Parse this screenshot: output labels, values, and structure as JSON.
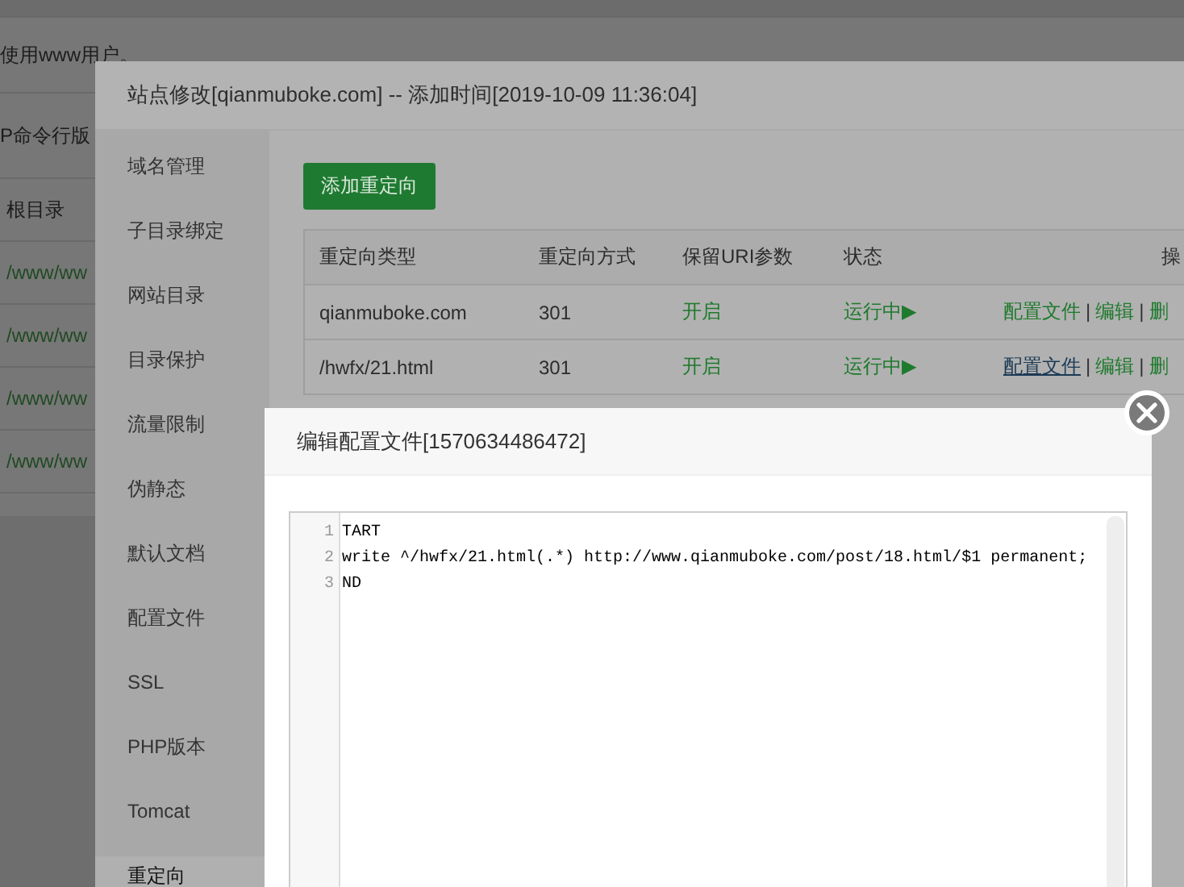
{
  "background_page": {
    "notice": "使用www用户。",
    "rows": [
      "P命令行版",
      "根目录",
      "/www/ww",
      "/www/ww",
      "/www/ww",
      "/www/ww"
    ]
  },
  "site_dialog": {
    "title": "站点修改[qianmuboke.com] -- 添加时间[2019-10-09 11:36:04]",
    "sidebar": {
      "items": [
        {
          "label": "域名管理",
          "selected": false
        },
        {
          "label": "子目录绑定",
          "selected": false
        },
        {
          "label": "网站目录",
          "selected": false
        },
        {
          "label": "目录保护",
          "selected": false
        },
        {
          "label": "流量限制",
          "selected": false
        },
        {
          "label": "伪静态",
          "selected": false
        },
        {
          "label": "默认文档",
          "selected": false
        },
        {
          "label": "配置文件",
          "selected": false
        },
        {
          "label": "SSL",
          "selected": false
        },
        {
          "label": "PHP版本",
          "selected": false
        },
        {
          "label": "Tomcat",
          "selected": false
        },
        {
          "label": "重定向",
          "selected": true
        }
      ]
    },
    "add_button": "添加重定向",
    "table": {
      "columns": [
        "重定向类型",
        "重定向方式",
        "保留URI参数",
        "状态",
        "操"
      ],
      "action_separator": "|",
      "rows": [
        {
          "type": "qianmuboke.com",
          "method": "301",
          "keep_uri": "开启",
          "status": "运行中▶",
          "actions": [
            {
              "label": "配置文件",
              "hover": false
            },
            {
              "label": "编辑",
              "hover": false
            },
            {
              "label": "删",
              "hover": false
            }
          ]
        },
        {
          "type": "/hwfx/21.html",
          "method": "301",
          "keep_uri": "开启",
          "status": "运行中▶",
          "actions": [
            {
              "label": "配置文件",
              "hover": true
            },
            {
              "label": "编辑",
              "hover": false
            },
            {
              "label": "删",
              "hover": false
            }
          ]
        }
      ]
    }
  },
  "config_dialog": {
    "title": "编辑配置文件[1570634486472]",
    "line_numbers": [
      "1",
      "2",
      "3"
    ],
    "lines": [
      "TART",
      "write ^/hwfx/21.html(.*) http://www.qianmuboke.com/post/18.html/$1 permanent;",
      "ND"
    ]
  }
}
